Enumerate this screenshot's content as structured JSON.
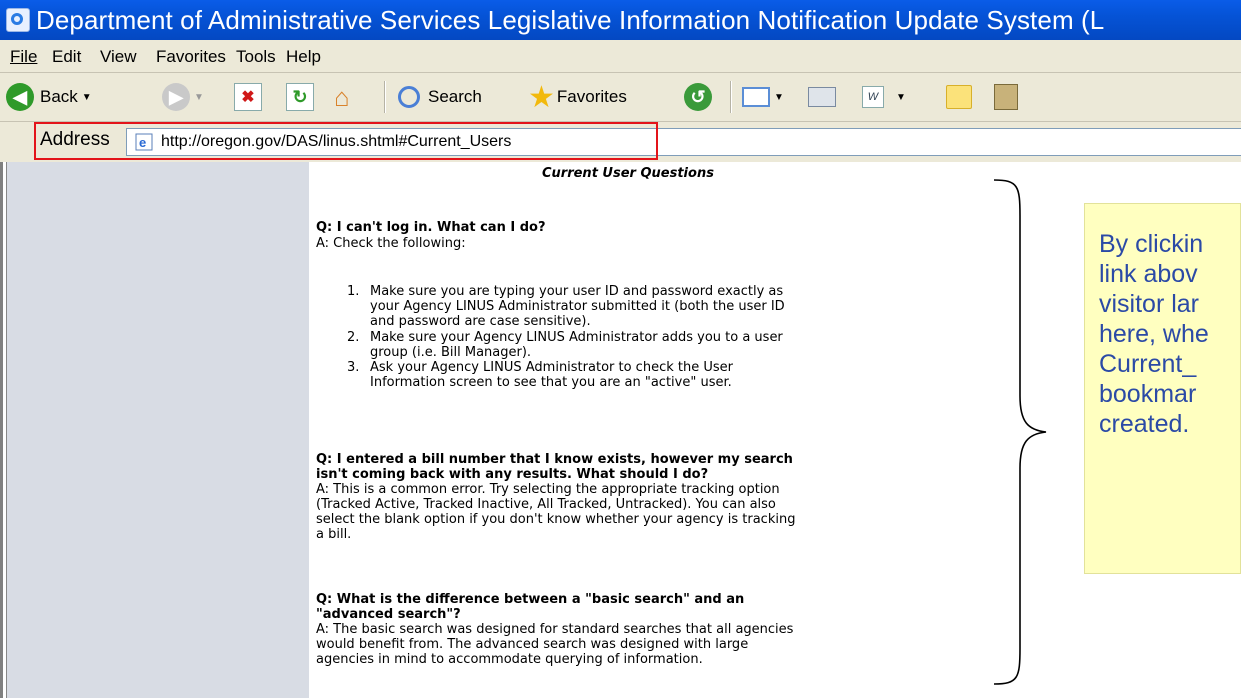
{
  "window": {
    "title": "Department of Administrative Services Legislative Information Notification Update System (L"
  },
  "menu": [
    "File",
    "Edit",
    "View",
    "Favorites",
    "Tools",
    "Help"
  ],
  "toolbar": {
    "back_label": "Back",
    "search_label": "Search",
    "favorites_label": "Favorites"
  },
  "address": {
    "label": "Address",
    "url": "http://oregon.gov/DAS/linus.shtml#Current_Users"
  },
  "page": {
    "heading": "Current User Questions",
    "q1": {
      "question": "Q: I can't log in. What can I do?",
      "answer": "A: Check the following:",
      "items": [
        {
          "num": "1.",
          "lines": [
            "Make sure you are typing your user ID and password exactly as",
            "your Agency LINUS Administrator submitted it (both the user ID",
            "and password are case sensitive)."
          ]
        },
        {
          "num": "2.",
          "lines": [
            "Make sure your Agency LINUS Administrator adds you to a user",
            "group (i.e. Bill Manager)."
          ]
        },
        {
          "num": "3.",
          "lines": [
            "Ask your Agency LINUS Administrator to check the User",
            "Information screen to see that you are an \"active\" user."
          ]
        }
      ]
    },
    "q2": {
      "question_lines": [
        "Q: I entered a bill number that I know exists, however my search",
        "isn't coming back with any results. What should I do?"
      ],
      "answer_lines": [
        "A: This is a common error. Try selecting the appropriate tracking option",
        "(Tracked Active, Tracked Inactive, All Tracked, Untracked). You can also",
        "select the blank option if you don't know whether your agency is tracking",
        "a bill."
      ]
    },
    "q3": {
      "question_lines": [
        "Q: What is the difference between a \"basic search\" and an",
        "\"advanced search\"?"
      ],
      "answer_lines": [
        "A: The basic search was designed for standard searches that all agencies",
        "would benefit from. The advanced search was designed with large",
        "agencies in mind to accommodate querying of information."
      ]
    }
  },
  "callout": {
    "lines": [
      "By clickin",
      "link abov",
      "visitor lar",
      "here, whe",
      "Current_",
      "bookmar",
      "created."
    ]
  },
  "colors": {
    "titlebar": "#0553d6",
    "highlight_box": "#e3141a",
    "callout_bg": "#ffffc0",
    "callout_text": "#2b4aa6",
    "side_panel": "#d8dce4"
  }
}
